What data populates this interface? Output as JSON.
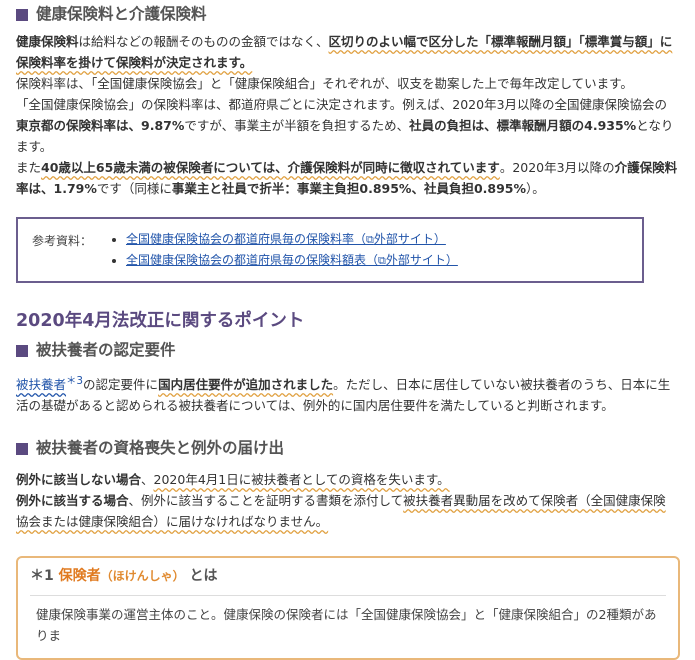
{
  "sec1": {
    "title": "健康保険料と介護保険料",
    "p1": [
      {
        "t": "健康保険料",
        "s": "b"
      },
      {
        "t": "は給料などの報酬そのものの金額ではなく、",
        "s": ""
      },
      {
        "t": "区切りのよい幅で区分した「標準報酬月額」「標準賞与額」に保険料率を掛けて保険料が決定されます。",
        "s": "bu"
      }
    ],
    "p2": "保険料率は、「全国健康保険協会」と「健康保険組合」それぞれが、収支を勘案した上で毎年改定しています。",
    "p3": [
      {
        "t": "「全国健康保険協会」の保険料率は、都道府県ごとに決定されます。例えば、2020年3月以降の全国健康保険協会の",
        "s": ""
      },
      {
        "t": "東京都の保険料率は、9.87%",
        "s": "b"
      },
      {
        "t": "ですが、事業主が半額を負担するため、",
        "s": ""
      },
      {
        "t": "社員の負担は、標準報酬月額の4.935%",
        "s": "b"
      },
      {
        "t": "となります。",
        "s": ""
      }
    ],
    "p4": [
      {
        "t": "また",
        "s": ""
      },
      {
        "t": "40歳以上65歳未満の被保険者については、介護保険料が同時に徴収されています",
        "s": "bu"
      },
      {
        "t": "。2020年3月以降の",
        "s": ""
      },
      {
        "t": "介護保険料率は、1.79%",
        "s": "b"
      },
      {
        "t": "です（同様に",
        "s": ""
      },
      {
        "t": "事業主と社員で折半：事業主負担0.895%、社員負担0.895%",
        "s": "b"
      },
      {
        "t": "）。",
        "s": ""
      }
    ]
  },
  "ref": {
    "label": "参考資料：",
    "links": [
      {
        "text": "全国健康保険協会の都道府県毎の保険料率（",
        "ext": "外部サイト）"
      },
      {
        "text": "全国健康保険協会の都道府県毎の保険料額表（",
        "ext": "外部サイト）"
      }
    ]
  },
  "h2": "2020年4月法改正に関するポイント",
  "sec2": {
    "title": "被扶養者の認定要件",
    "link": "被扶養者",
    "sup": "＊3",
    "p": [
      {
        "t": "の認定要件に",
        "s": ""
      },
      {
        "t": "国内居住要件が追加されました",
        "s": "bu"
      },
      {
        "t": "。ただし、日本に居住していない被扶養者のうち、日本に生活の基礎があると認められる被扶養者については、例外的に国内居住要件を満たしていると判断されます。",
        "s": ""
      }
    ]
  },
  "sec3": {
    "title": "被扶養者の資格喪失と例外の届け出",
    "p1": [
      {
        "t": "例外に該当しない場合",
        "s": "b"
      },
      {
        "t": "、",
        "s": ""
      },
      {
        "t": "2020年4月1日に被扶養者としての資格を失います。",
        "s": "u"
      }
    ],
    "p2": [
      {
        "t": "例外に該当する場合",
        "s": "b"
      },
      {
        "t": "、例外に該当することを証明する書類を添付して",
        "s": ""
      },
      {
        "t": "被扶養者異動届を改めて保険者（全国健康保険協会または健康保険組合）に届けなければなりません。",
        "s": "u"
      }
    ]
  },
  "note": {
    "mark": "＊1",
    "term": "保険者",
    "reading": "（ほけんしゃ）",
    "suffix": "とは",
    "body": "健康保険事業の運営主体のこと。健康保険の保険者には「全国健康保険協会」と「健康保険組合」の2種類がありま"
  }
}
